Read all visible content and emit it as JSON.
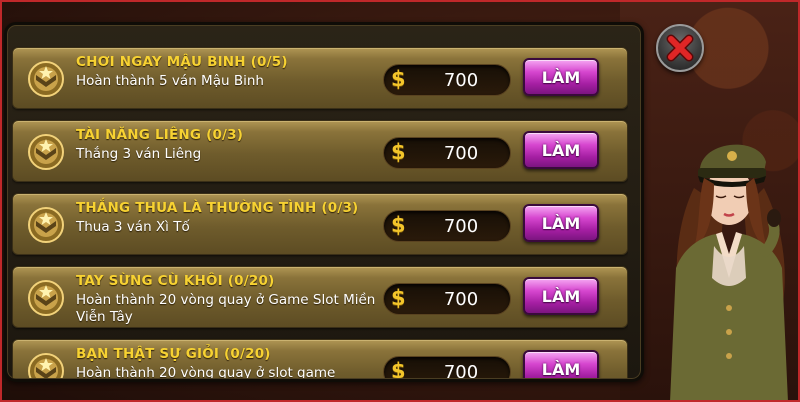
{
  "quests": [
    {
      "title": "CHƠI NGAY MẬU BINH (0/5)",
      "description": "Hoàn thành 5 ván Mậu Binh",
      "reward_symbol": "$",
      "reward": "700",
      "action_label": "LÀM"
    },
    {
      "title": "TÀI NĂNG LIÊNG (0/3)",
      "description": "Thắng 3 ván Liêng",
      "reward_symbol": "$",
      "reward": "700",
      "action_label": "LÀM"
    },
    {
      "title": "THẮNG THUA LÀ THƯỜNG TÌNH (0/3)",
      "description": "Thua 3 ván Xì Tố",
      "reward_symbol": "$",
      "reward": "700",
      "action_label": "LÀM"
    },
    {
      "title": "TAY SỪNG CÙ KHÔI (0/20)",
      "description": "Hoàn thành 20 vòng quay ở Game Slot Miền Viễn Tây",
      "reward_symbol": "$",
      "reward": "700",
      "action_label": "LÀM"
    },
    {
      "title": "BẠN THẬT SỰ GIỎI (0/20)",
      "description": "Hoàn thành 20 vòng quay ở slot game",
      "reward_symbol": "$",
      "reward": "700",
      "action_label": "LÀM"
    }
  ],
  "icons": {
    "close": "close-x-icon",
    "medal": "rank-medal-icon",
    "coin": "dollar-coin-icon"
  },
  "colors": {
    "title": "#f7d232",
    "button": "#c23bc0",
    "close_x": "#e02626"
  }
}
